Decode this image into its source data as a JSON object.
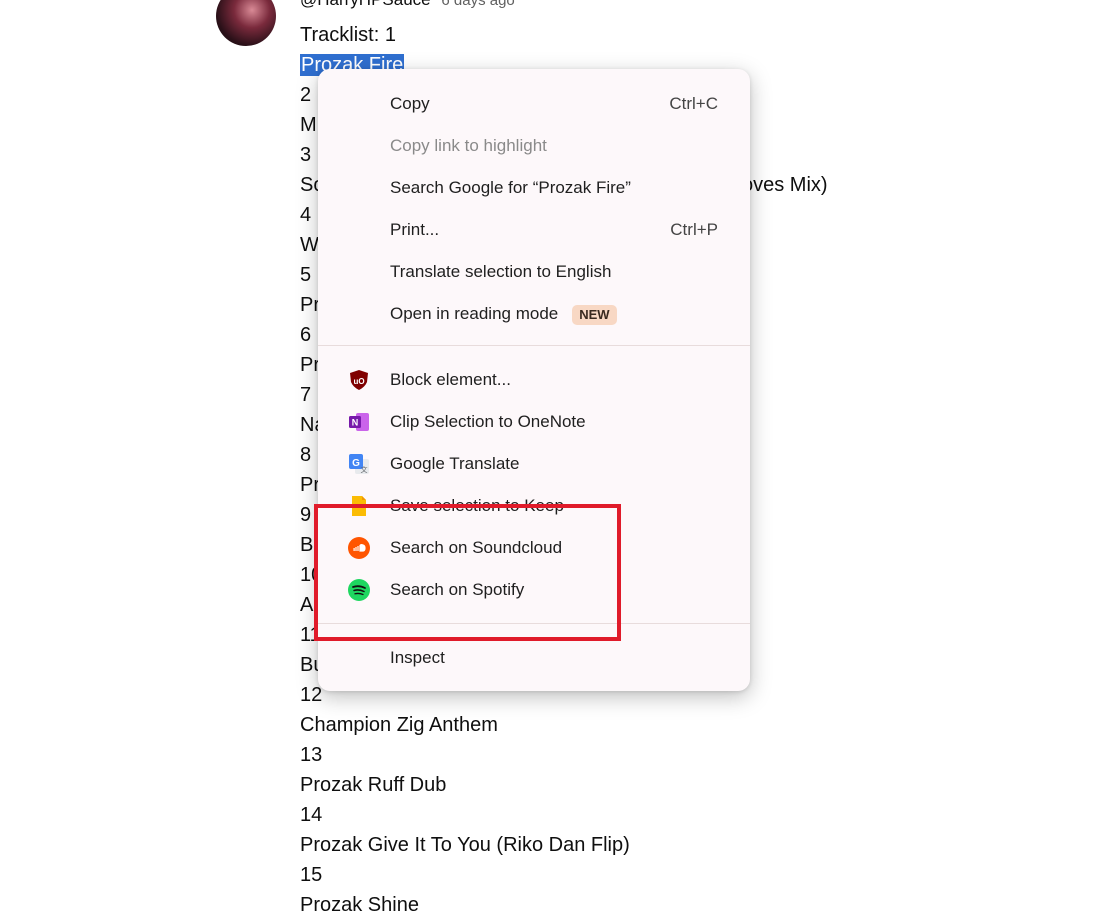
{
  "comment": {
    "author": "@HarryHPSauce",
    "time": "6 days ago",
    "overflow_text": "oves Mix)",
    "lines": [
      "Tracklist: 1",
      "Prozak Fire",
      "2",
      "M",
      "3",
      "So",
      "4",
      "W",
      "5",
      "Pr",
      "6",
      "Pr",
      "7",
      "Na",
      "8",
      "Pr",
      "9",
      "B",
      "10",
      "A",
      "11",
      "Bu",
      "12",
      "Champion Zig Anthem",
      "13",
      "Prozak Ruff Dub",
      "14",
      "Prozak Give It To You (Riko Dan Flip)",
      "15",
      "Prozak Shine"
    ]
  },
  "menu": {
    "copy": {
      "label": "Copy",
      "shortcut": "Ctrl+C"
    },
    "copy_link": {
      "label": "Copy link to highlight"
    },
    "search_google": {
      "label": "Search Google for “Prozak Fire”"
    },
    "print": {
      "label": "Print...",
      "shortcut": "Ctrl+P"
    },
    "translate": {
      "label": "Translate selection to English"
    },
    "reading_mode": {
      "label": "Open in reading mode",
      "badge": "NEW"
    },
    "block": {
      "label": "Block element...",
      "icon": "ublock-icon"
    },
    "onenote": {
      "label": "Clip Selection to OneNote",
      "icon": "onenote-icon"
    },
    "google_translate": {
      "label": "Google Translate",
      "icon": "google-translate-icon"
    },
    "keep": {
      "label": "Save selection to Keep",
      "icon": "keep-icon"
    },
    "soundcloud": {
      "label": "Search on Soundcloud",
      "icon": "soundcloud-icon"
    },
    "spotify": {
      "label": "Search on Spotify",
      "icon": "spotify-icon"
    },
    "inspect": {
      "label": "Inspect"
    }
  },
  "colors": {
    "selection": "#2f6fd0",
    "highlight_box": "#e01b2a",
    "soundcloud": "#ff5500",
    "spotify": "#1ed760"
  }
}
